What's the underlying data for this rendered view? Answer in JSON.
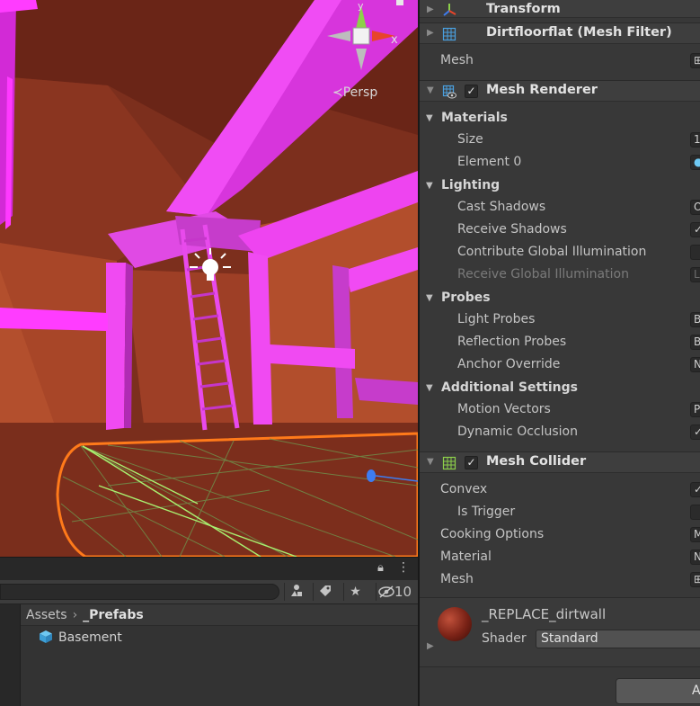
{
  "scene": {
    "view_label": "Persp",
    "gizmo_y": "y",
    "gizmo_x": "x"
  },
  "project": {
    "hidden_count": "10",
    "breadcrumb": [
      "Assets",
      "_Prefabs"
    ],
    "items": [
      {
        "name": "Basement",
        "icon": "prefab-cube-icon"
      }
    ]
  },
  "inspector": {
    "components": {
      "transform": "Transform",
      "mesh_filter": "Dirtfloorflat (Mesh Filter)",
      "mesh_renderer": "Mesh Renderer",
      "mesh_collider": "Mesh Collider"
    },
    "mesh_filter_rows": {
      "mesh": "Mesh"
    },
    "renderer": {
      "materials": {
        "title": "Materials",
        "size_label": "Size",
        "size_value": "1",
        "element0_label": "Element 0"
      },
      "lighting": {
        "title": "Lighting",
        "cast_shadows": "Cast Shadows",
        "cast_shadows_value": "On",
        "receive_shadows": "Receive Shadows",
        "contribute_gi": "Contribute Global Illumination",
        "receive_gi": "Receive Global Illumination",
        "receive_gi_value": "Lightmaps"
      },
      "probes": {
        "title": "Probes",
        "light_probes": "Light Probes",
        "light_probes_value": "Blend Probes",
        "reflection_probes": "Reflection Probes",
        "reflection_probes_value": "Blend Probes",
        "anchor_override": "Anchor Override",
        "anchor_override_value": "None (Transform)"
      },
      "additional": {
        "title": "Additional Settings",
        "motion_vectors": "Motion Vectors",
        "motion_vectors_value": "Per Object Motion",
        "dynamic_occlusion": "Dynamic Occlusion"
      }
    },
    "collider": {
      "convex": "Convex",
      "is_trigger": "Is Trigger",
      "cooking_options": "Cooking Options",
      "cooking_options_value": "Mixed...",
      "material": "Material",
      "material_value": "None (Physic Material)",
      "mesh": "Mesh"
    },
    "material": {
      "name": "_REPLACE_dirtwall",
      "shader_label": "Shader",
      "shader_value": "Standard"
    },
    "add_component": "Add Component"
  }
}
